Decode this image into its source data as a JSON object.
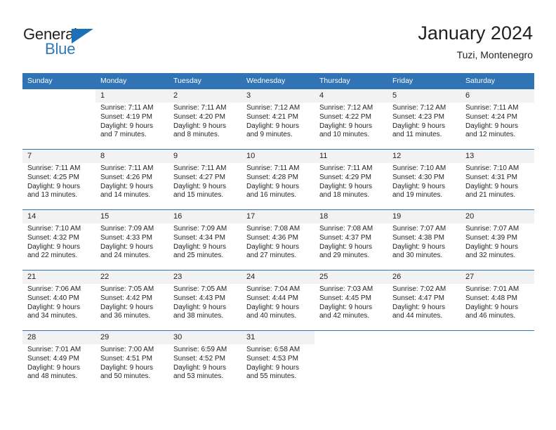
{
  "brand": {
    "name_part1": "General",
    "name_part2": "Blue",
    "triangle_color": "#1b70b8",
    "text_color": "#231f20"
  },
  "header": {
    "title": "January 2024",
    "subtitle": "Tuzi, Montenegro",
    "accent_color": "#3174b5",
    "daynum_band_color": "#f2f2f2"
  },
  "weekdays": [
    "Sunday",
    "Monday",
    "Tuesday",
    "Wednesday",
    "Thursday",
    "Friday",
    "Saturday"
  ],
  "weeks": [
    [
      {
        "day": "",
        "sunrise": "",
        "sunset": "",
        "daylight_line1": "",
        "daylight_line2": ""
      },
      {
        "day": "1",
        "sunrise": "Sunrise: 7:11 AM",
        "sunset": "Sunset: 4:19 PM",
        "daylight_line1": "Daylight: 9 hours",
        "daylight_line2": "and 7 minutes."
      },
      {
        "day": "2",
        "sunrise": "Sunrise: 7:11 AM",
        "sunset": "Sunset: 4:20 PM",
        "daylight_line1": "Daylight: 9 hours",
        "daylight_line2": "and 8 minutes."
      },
      {
        "day": "3",
        "sunrise": "Sunrise: 7:12 AM",
        "sunset": "Sunset: 4:21 PM",
        "daylight_line1": "Daylight: 9 hours",
        "daylight_line2": "and 9 minutes."
      },
      {
        "day": "4",
        "sunrise": "Sunrise: 7:12 AM",
        "sunset": "Sunset: 4:22 PM",
        "daylight_line1": "Daylight: 9 hours",
        "daylight_line2": "and 10 minutes."
      },
      {
        "day": "5",
        "sunrise": "Sunrise: 7:12 AM",
        "sunset": "Sunset: 4:23 PM",
        "daylight_line1": "Daylight: 9 hours",
        "daylight_line2": "and 11 minutes."
      },
      {
        "day": "6",
        "sunrise": "Sunrise: 7:11 AM",
        "sunset": "Sunset: 4:24 PM",
        "daylight_line1": "Daylight: 9 hours",
        "daylight_line2": "and 12 minutes."
      }
    ],
    [
      {
        "day": "7",
        "sunrise": "Sunrise: 7:11 AM",
        "sunset": "Sunset: 4:25 PM",
        "daylight_line1": "Daylight: 9 hours",
        "daylight_line2": "and 13 minutes."
      },
      {
        "day": "8",
        "sunrise": "Sunrise: 7:11 AM",
        "sunset": "Sunset: 4:26 PM",
        "daylight_line1": "Daylight: 9 hours",
        "daylight_line2": "and 14 minutes."
      },
      {
        "day": "9",
        "sunrise": "Sunrise: 7:11 AM",
        "sunset": "Sunset: 4:27 PM",
        "daylight_line1": "Daylight: 9 hours",
        "daylight_line2": "and 15 minutes."
      },
      {
        "day": "10",
        "sunrise": "Sunrise: 7:11 AM",
        "sunset": "Sunset: 4:28 PM",
        "daylight_line1": "Daylight: 9 hours",
        "daylight_line2": "and 16 minutes."
      },
      {
        "day": "11",
        "sunrise": "Sunrise: 7:11 AM",
        "sunset": "Sunset: 4:29 PM",
        "daylight_line1": "Daylight: 9 hours",
        "daylight_line2": "and 18 minutes."
      },
      {
        "day": "12",
        "sunrise": "Sunrise: 7:10 AM",
        "sunset": "Sunset: 4:30 PM",
        "daylight_line1": "Daylight: 9 hours",
        "daylight_line2": "and 19 minutes."
      },
      {
        "day": "13",
        "sunrise": "Sunrise: 7:10 AM",
        "sunset": "Sunset: 4:31 PM",
        "daylight_line1": "Daylight: 9 hours",
        "daylight_line2": "and 21 minutes."
      }
    ],
    [
      {
        "day": "14",
        "sunrise": "Sunrise: 7:10 AM",
        "sunset": "Sunset: 4:32 PM",
        "daylight_line1": "Daylight: 9 hours",
        "daylight_line2": "and 22 minutes."
      },
      {
        "day": "15",
        "sunrise": "Sunrise: 7:09 AM",
        "sunset": "Sunset: 4:33 PM",
        "daylight_line1": "Daylight: 9 hours",
        "daylight_line2": "and 24 minutes."
      },
      {
        "day": "16",
        "sunrise": "Sunrise: 7:09 AM",
        "sunset": "Sunset: 4:34 PM",
        "daylight_line1": "Daylight: 9 hours",
        "daylight_line2": "and 25 minutes."
      },
      {
        "day": "17",
        "sunrise": "Sunrise: 7:08 AM",
        "sunset": "Sunset: 4:36 PM",
        "daylight_line1": "Daylight: 9 hours",
        "daylight_line2": "and 27 minutes."
      },
      {
        "day": "18",
        "sunrise": "Sunrise: 7:08 AM",
        "sunset": "Sunset: 4:37 PM",
        "daylight_line1": "Daylight: 9 hours",
        "daylight_line2": "and 29 minutes."
      },
      {
        "day": "19",
        "sunrise": "Sunrise: 7:07 AM",
        "sunset": "Sunset: 4:38 PM",
        "daylight_line1": "Daylight: 9 hours",
        "daylight_line2": "and 30 minutes."
      },
      {
        "day": "20",
        "sunrise": "Sunrise: 7:07 AM",
        "sunset": "Sunset: 4:39 PM",
        "daylight_line1": "Daylight: 9 hours",
        "daylight_line2": "and 32 minutes."
      }
    ],
    [
      {
        "day": "21",
        "sunrise": "Sunrise: 7:06 AM",
        "sunset": "Sunset: 4:40 PM",
        "daylight_line1": "Daylight: 9 hours",
        "daylight_line2": "and 34 minutes."
      },
      {
        "day": "22",
        "sunrise": "Sunrise: 7:05 AM",
        "sunset": "Sunset: 4:42 PM",
        "daylight_line1": "Daylight: 9 hours",
        "daylight_line2": "and 36 minutes."
      },
      {
        "day": "23",
        "sunrise": "Sunrise: 7:05 AM",
        "sunset": "Sunset: 4:43 PM",
        "daylight_line1": "Daylight: 9 hours",
        "daylight_line2": "and 38 minutes."
      },
      {
        "day": "24",
        "sunrise": "Sunrise: 7:04 AM",
        "sunset": "Sunset: 4:44 PM",
        "daylight_line1": "Daylight: 9 hours",
        "daylight_line2": "and 40 minutes."
      },
      {
        "day": "25",
        "sunrise": "Sunrise: 7:03 AM",
        "sunset": "Sunset: 4:45 PM",
        "daylight_line1": "Daylight: 9 hours",
        "daylight_line2": "and 42 minutes."
      },
      {
        "day": "26",
        "sunrise": "Sunrise: 7:02 AM",
        "sunset": "Sunset: 4:47 PM",
        "daylight_line1": "Daylight: 9 hours",
        "daylight_line2": "and 44 minutes."
      },
      {
        "day": "27",
        "sunrise": "Sunrise: 7:01 AM",
        "sunset": "Sunset: 4:48 PM",
        "daylight_line1": "Daylight: 9 hours",
        "daylight_line2": "and 46 minutes."
      }
    ],
    [
      {
        "day": "28",
        "sunrise": "Sunrise: 7:01 AM",
        "sunset": "Sunset: 4:49 PM",
        "daylight_line1": "Daylight: 9 hours",
        "daylight_line2": "and 48 minutes."
      },
      {
        "day": "29",
        "sunrise": "Sunrise: 7:00 AM",
        "sunset": "Sunset: 4:51 PM",
        "daylight_line1": "Daylight: 9 hours",
        "daylight_line2": "and 50 minutes."
      },
      {
        "day": "30",
        "sunrise": "Sunrise: 6:59 AM",
        "sunset": "Sunset: 4:52 PM",
        "daylight_line1": "Daylight: 9 hours",
        "daylight_line2": "and 53 minutes."
      },
      {
        "day": "31",
        "sunrise": "Sunrise: 6:58 AM",
        "sunset": "Sunset: 4:53 PM",
        "daylight_line1": "Daylight: 9 hours",
        "daylight_line2": "and 55 minutes."
      },
      {
        "day": "",
        "sunrise": "",
        "sunset": "",
        "daylight_line1": "",
        "daylight_line2": ""
      },
      {
        "day": "",
        "sunrise": "",
        "sunset": "",
        "daylight_line1": "",
        "daylight_line2": ""
      },
      {
        "day": "",
        "sunrise": "",
        "sunset": "",
        "daylight_line1": "",
        "daylight_line2": ""
      }
    ]
  ]
}
